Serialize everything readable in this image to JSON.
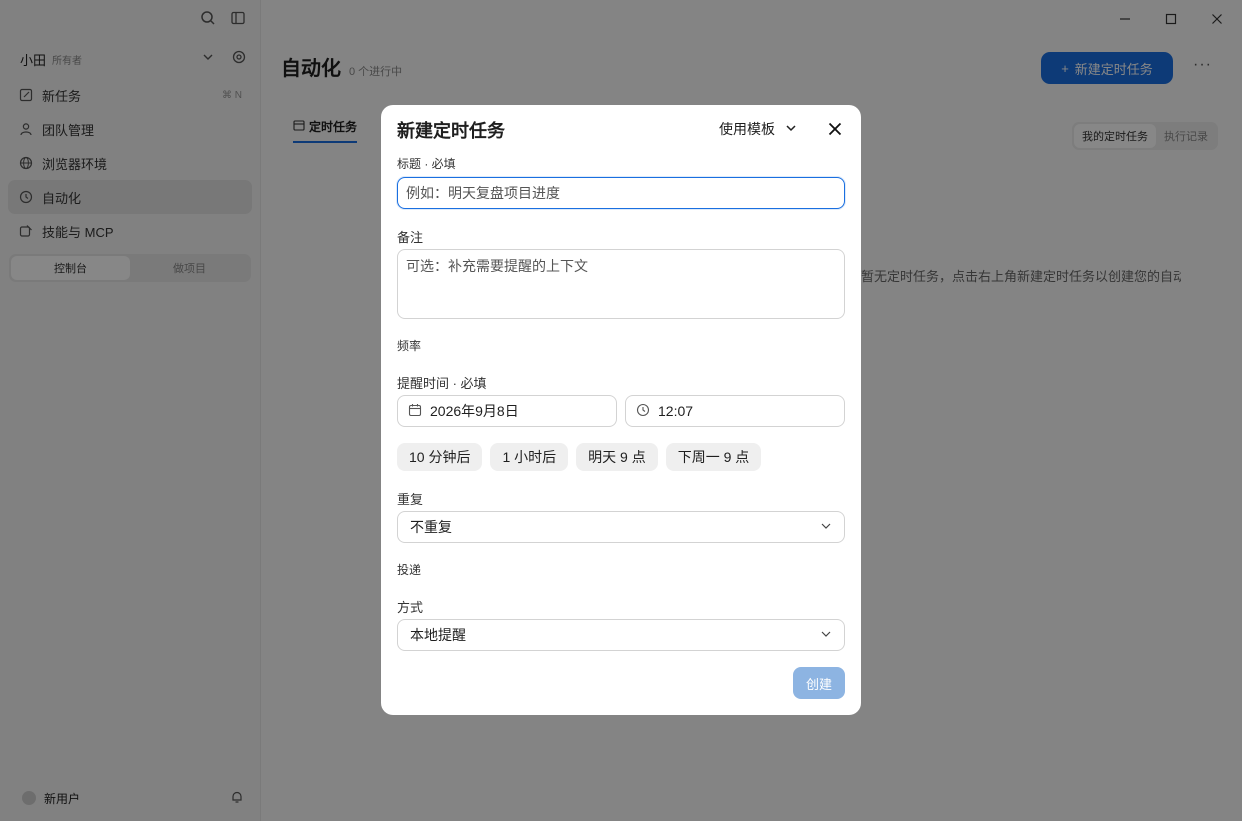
{
  "sidebar": {
    "workspace_name": "小田",
    "workspace_role": "所有者",
    "items": [
      {
        "label": "新任务",
        "kbd": "⌘ N"
      },
      {
        "label": "团队管理"
      },
      {
        "label": "浏览器环境"
      },
      {
        "label": "自动化"
      },
      {
        "label": "技能与 MCP"
      }
    ],
    "segment": [
      "控制台",
      "做项目"
    ],
    "user_label": "新用户"
  },
  "main": {
    "title": "自动化",
    "subtitle": "0 个进行中",
    "new_button": "新建定时任务",
    "tab_active": "定时任务",
    "segment": [
      "我的定时任务",
      "执行记录"
    ],
    "empty_text": "暂无定时任务，点击右上角新建定时任务以创建您的自动化工"
  },
  "modal": {
    "title": "新建定时任务",
    "template_label": "使用模板",
    "title_field": {
      "label": "标题 · 必填",
      "placeholder": "例如：明天复盘项目进度",
      "value": ""
    },
    "note_field": {
      "label": "备注",
      "placeholder": "可选：补充需要提醒的上下文"
    },
    "frequency_label": "频率",
    "reminder": {
      "label": "提醒时间 · 必填",
      "date": "2026年9月8日",
      "time": "12:07"
    },
    "quick_chips": [
      "10 分钟后",
      "1 小时后",
      "明天 9 点",
      "下周一 9 点"
    ],
    "repeat": {
      "label": "重复",
      "value": "不重复"
    },
    "delivery_label": "投递",
    "method": {
      "label": "方式",
      "value": "本地提醒"
    },
    "create_button": "创建"
  },
  "colors": {
    "accent": "#1a6fe0",
    "create_disabled": "#8db4e2",
    "overlay": "rgba(0,0,0,0.47)"
  }
}
